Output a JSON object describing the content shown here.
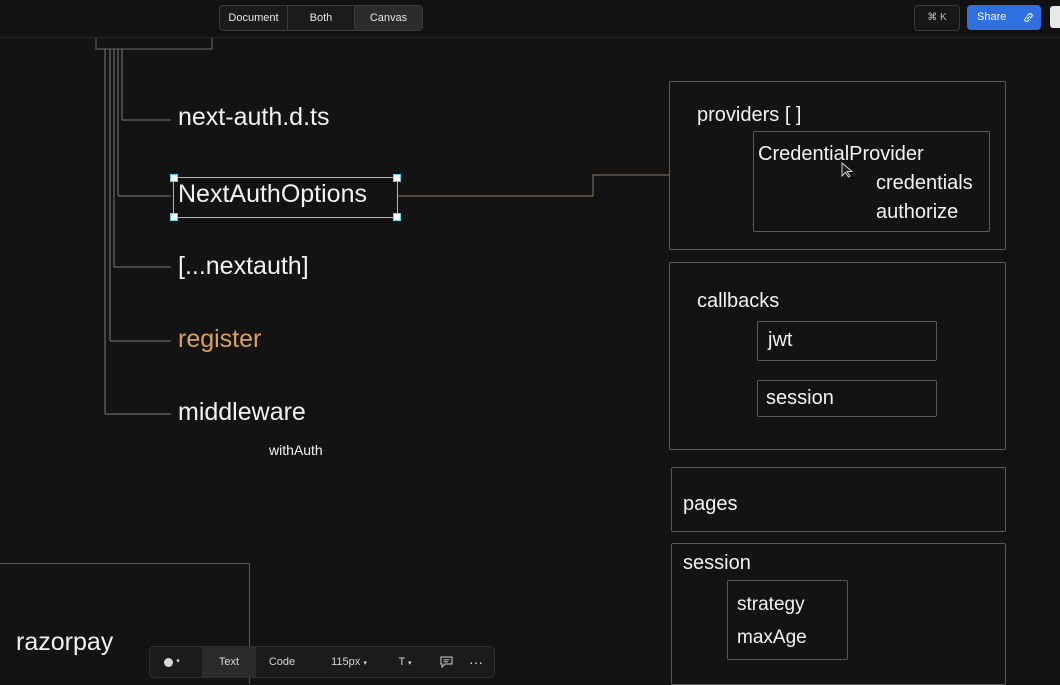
{
  "topbar": {
    "view_toggle": [
      "Document",
      "Both",
      "Canvas"
    ],
    "active_view": "Canvas",
    "command_shortcut": "⌘ K",
    "share_label": "Share"
  },
  "canvas": {
    "tree_items": {
      "next_auth_dts": "next-auth.d.ts",
      "next_auth_options": "NextAuthOptions",
      "nextauth_route": "[...nextauth]",
      "register": "register",
      "middleware": "middleware",
      "with_auth": "withAuth"
    },
    "providers": {
      "title": "providers [ ]",
      "credential_provider": "CredentialProvider",
      "credentials": "credentials",
      "authorize": "authorize"
    },
    "callbacks": {
      "title": "callbacks",
      "jwt": "jwt",
      "session": "session"
    },
    "pages": {
      "title": "pages"
    },
    "session": {
      "title": "session",
      "strategy": "strategy",
      "max_age": "maxAge"
    },
    "razorpay": "razorpay",
    "colors": {
      "accent_register": "#d9a05b",
      "selection": "#5fd6e8",
      "share_button": "#2f6fe0"
    }
  },
  "bottom_toolbar": {
    "text_label": "Text",
    "code_label": "Code",
    "font_size": "115px",
    "text_style": "T",
    "active_mode": "Text"
  }
}
